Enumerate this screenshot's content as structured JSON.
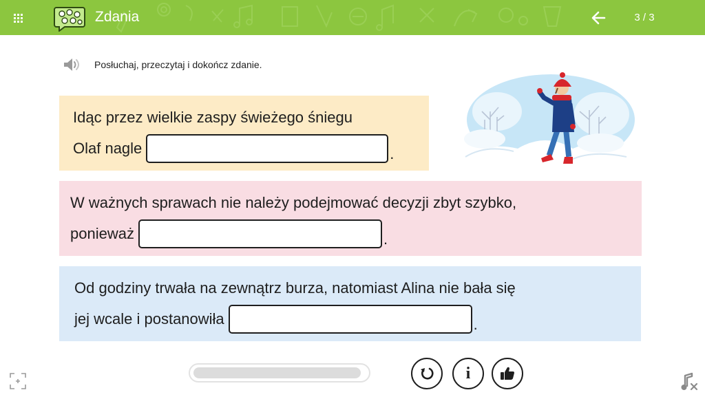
{
  "header": {
    "title": "Zdania",
    "page_indicator": "3 / 3",
    "bar_color": "#8cc63f",
    "icons": {
      "menu": "grid-icon",
      "app": "speech-bubble-icon",
      "back": "arrow-left-icon"
    }
  },
  "instruction": {
    "text": "Posłuchaj, przeczytaj i dokończ zdanie.",
    "icon": "speaker-icon"
  },
  "sentences": [
    {
      "color": "#fdebc6",
      "line1": "Idąc przez wielkie zaspy świeżego śniegu",
      "line2_prefix": "Olaf nagle",
      "answer": "",
      "ending": "."
    },
    {
      "color": "#f9dde3",
      "line1": "W ważnych sprawach nie należy podejmować decyzji zbyt szybko,",
      "line2_prefix": "ponieważ",
      "answer": "",
      "ending": "."
    },
    {
      "color": "#dbeaf8",
      "line1": "Od godziny trwała na zewnątrz burza, natomiast Alina nie bała się",
      "line2_prefix": "jej wcale i postanowiła",
      "answer": "",
      "ending": "."
    }
  ],
  "illustration": "boy-walking-in-snow-illustration",
  "progress": {
    "value": 0.97
  },
  "controls": {
    "reset_icon": "reset-icon",
    "info_glyph": "i",
    "check_icon": "thumbs-up-icon",
    "expand_icon": "expand-icon",
    "music_icon": "music-mute-icon"
  }
}
